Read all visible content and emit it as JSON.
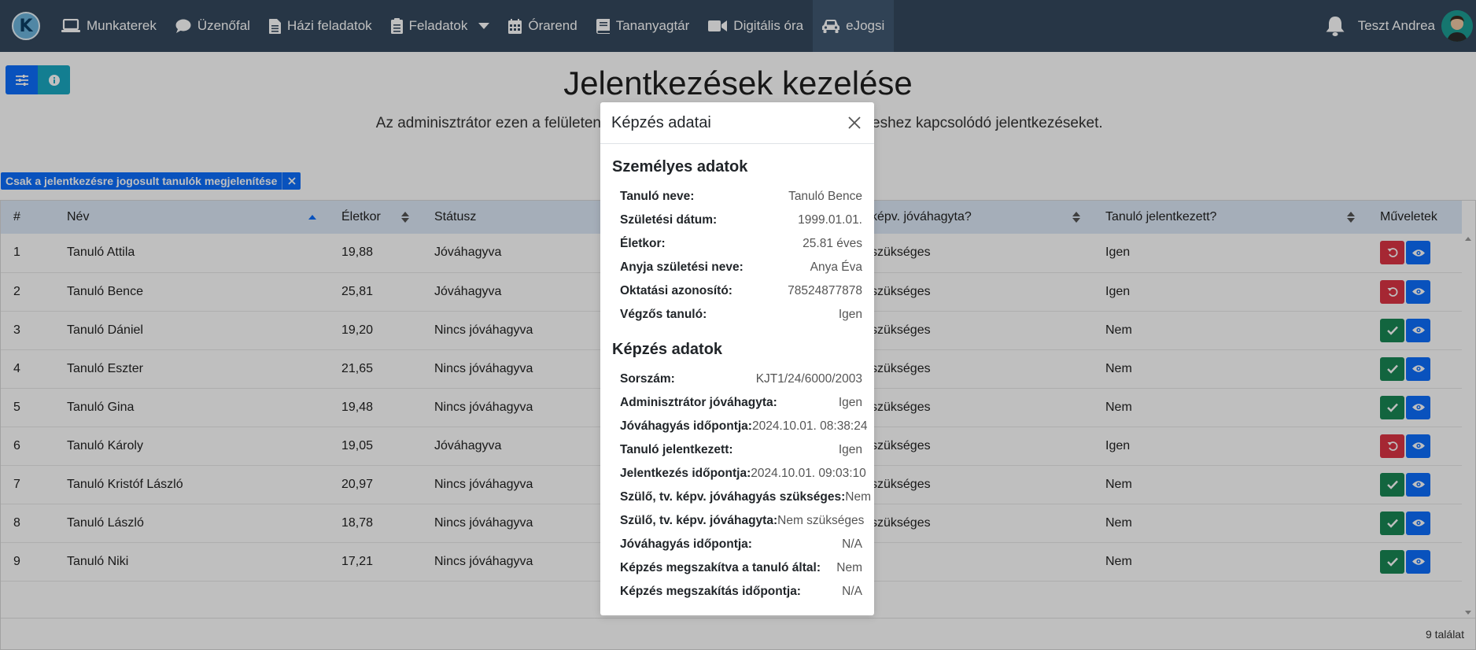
{
  "nav": {
    "brand": "K",
    "items": [
      {
        "label": "Munkaterek",
        "icon": "laptop-icon"
      },
      {
        "label": "Üzenőfal",
        "icon": "comment-icon"
      },
      {
        "label": "Házi feladatok",
        "icon": "file-icon"
      },
      {
        "label": "Feladatok",
        "icon": "clipboard-icon"
      },
      {
        "label": "Órarend",
        "icon": "calendar-icon"
      },
      {
        "label": "Tananyagtár",
        "icon": "book-icon"
      },
      {
        "label": "Digitális óra",
        "icon": "video-camera-icon"
      },
      {
        "label": "eJogsi",
        "icon": "car-icon"
      }
    ],
    "user_name": "Teszt Andrea"
  },
  "page": {
    "title": "Jelentkezések kezelése",
    "subtitle_left": "Az adminisztrátor ezen a felületen",
    "subtitle_right": "eshez kapcsolódó jelentkezéseket."
  },
  "filter": {
    "chip_label": "Csak a jelentkezésre jogosult tanulók megjelenítése"
  },
  "table": {
    "columns": {
      "num": "#",
      "name": "Név",
      "age": "Életkor",
      "status": "Státusz",
      "parent_approved": "képv. jóváhagyta?",
      "student_applied": "Tanuló jelentkezett?",
      "actions": "Műveletek"
    },
    "rows": [
      {
        "num": "1",
        "name": "Tanuló Attila",
        "age": "19,88",
        "status": "Jóváhagyva",
        "parent": "szükséges",
        "applied": "Igen",
        "action": "revoke"
      },
      {
        "num": "2",
        "name": "Tanuló Bence",
        "age": "25,81",
        "status": "Jóváhagyva",
        "parent": "szükséges",
        "applied": "Igen",
        "action": "revoke"
      },
      {
        "num": "3",
        "name": "Tanuló Dániel",
        "age": "19,20",
        "status": "Nincs jóváhagyva",
        "parent": "szükséges",
        "applied": "Nem",
        "action": "approve"
      },
      {
        "num": "4",
        "name": "Tanuló Eszter",
        "age": "21,65",
        "status": "Nincs jóváhagyva",
        "parent": "szükséges",
        "applied": "Nem",
        "action": "approve"
      },
      {
        "num": "5",
        "name": "Tanuló Gina",
        "age": "19,48",
        "status": "Nincs jóváhagyva",
        "parent": "szükséges",
        "applied": "Nem",
        "action": "approve"
      },
      {
        "num": "6",
        "name": "Tanuló Károly",
        "age": "19,05",
        "status": "Jóváhagyva",
        "parent": "szükséges",
        "applied": "Igen",
        "action": "revoke"
      },
      {
        "num": "7",
        "name": "Tanuló Kristóf László",
        "age": "20,97",
        "status": "Nincs jóváhagyva",
        "parent": "szükséges",
        "applied": "Nem",
        "action": "approve"
      },
      {
        "num": "8",
        "name": "Tanuló László",
        "age": "18,78",
        "status": "Nincs jóváhagyva",
        "parent": "szükséges",
        "applied": "Nem",
        "action": "approve"
      },
      {
        "num": "9",
        "name": "Tanuló Niki",
        "age": "17,21",
        "status": "Nincs jóváhagyva",
        "parent": "",
        "applied": "Nem",
        "action": "approve"
      }
    ],
    "footer": "9 találat"
  },
  "modal": {
    "title": "Képzés adatai",
    "personal_title": "Személyes adatok",
    "personal": [
      {
        "label": "Tanuló neve:",
        "value": "Tanuló Bence"
      },
      {
        "label": "Születési dátum:",
        "value": "1999.01.01."
      },
      {
        "label": "Életkor:",
        "value": "25.81 éves"
      },
      {
        "label": "Anyja születési neve:",
        "value": "Anya Éva"
      },
      {
        "label": "Oktatási azonosító:",
        "value": "78524877878"
      },
      {
        "label": "Végzős tanuló:",
        "value": "Igen"
      }
    ],
    "training_title": "Képzés adatok",
    "training": [
      {
        "label": "Sorszám:",
        "value": "KJT1/24/6000/2003"
      },
      {
        "label": "Adminisztrátor jóváhagyta:",
        "value": "Igen"
      },
      {
        "label": "Jóváhagyás időpontja:",
        "value": "2024.10.01. 08:38:24"
      },
      {
        "label": "Tanuló jelentkezett:",
        "value": "Igen"
      },
      {
        "label": "Jelentkezés időpontja:",
        "value": "2024.10.01. 09:03:10"
      },
      {
        "label": "Szülő, tv. képv. jóváhagyás szükséges:",
        "value": "Nem"
      },
      {
        "label": "Szülő, tv. képv. jóváhagyta:",
        "value": "Nem szükséges"
      },
      {
        "label": "Jóváhagyás időpontja:",
        "value": "N/A"
      },
      {
        "label": "Képzés megszakítva a tanuló által:",
        "value": "Nem"
      },
      {
        "label": "Képzés megszakítás időpontja:",
        "value": "N/A"
      }
    ]
  },
  "colors": {
    "navbar": "#34495e",
    "primary": "#0d6efd",
    "success": "#198754",
    "danger": "#dc3545",
    "info": "#1aa9c2",
    "table_header": "#dde9f7"
  }
}
